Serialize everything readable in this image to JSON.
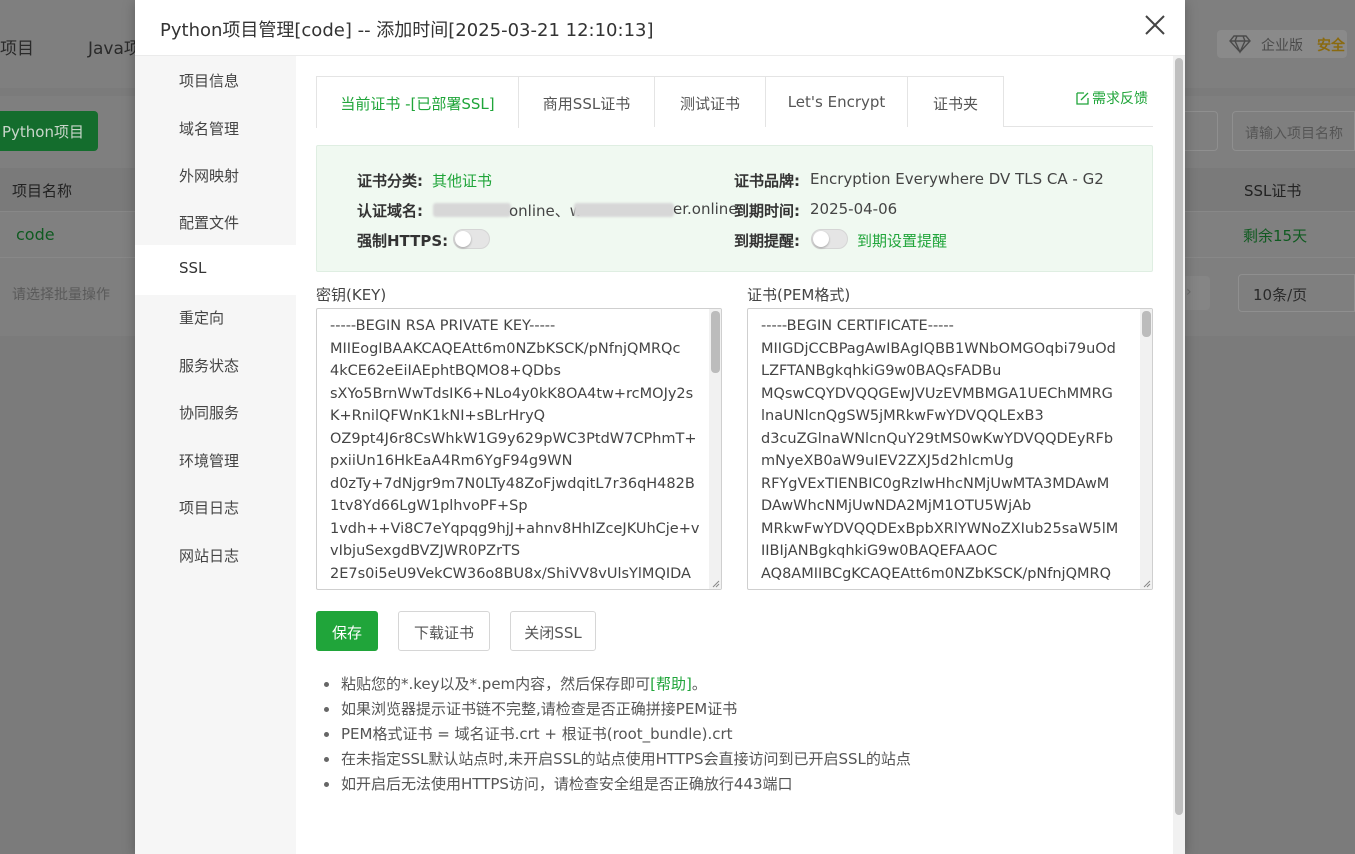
{
  "background": {
    "nav": [
      "项目",
      "Java项"
    ],
    "brand_edition": "企业版",
    "brand_security": "安全",
    "add_project_button": "Python项目",
    "search_placeholder": "请输入项目名称",
    "col_project_name": "项目名称",
    "col_ssl": "SSL证书",
    "row_name": "code",
    "row_ssl": "剩余15天",
    "batch_placeholder": "请选择批量操作",
    "page_size": "10条/页"
  },
  "dialog": {
    "title": "Python项目管理[code] -- 添加时间[2025-03-21 12:10:13]",
    "sidebar": [
      {
        "label": "项目信息"
      },
      {
        "label": "域名管理"
      },
      {
        "label": "外网映射"
      },
      {
        "label": "配置文件"
      },
      {
        "label": "SSL"
      },
      {
        "label": "重定向"
      },
      {
        "label": "服务状态"
      },
      {
        "label": "协同服务"
      },
      {
        "label": "环境管理"
      },
      {
        "label": "项目日志"
      },
      {
        "label": "网站日志"
      }
    ],
    "tabs": [
      {
        "label": "当前证书 -[已部署SSL]"
      },
      {
        "label": "商用SSL证书"
      },
      {
        "label": "测试证书"
      },
      {
        "label": "Let's Encrypt"
      },
      {
        "label": "证书夹"
      }
    ],
    "feedback": "需求反馈",
    "cert_info": {
      "category_label": "证书分类:",
      "category_value": "其他证书",
      "brand_label": "证书品牌:",
      "brand_value": "Encryption Everywhere DV TLS CA - G2",
      "domain_label": "认证域名:",
      "domain_value_a": "online、w",
      "domain_value_b": "er.online",
      "expiry_label": "到期时间:",
      "expiry_value": "2025-04-06",
      "force_https_label": "强制HTTPS:",
      "reminder_label": "到期提醒:",
      "reminder_link": "到期设置提醒"
    },
    "key_label": "密钥(KEY)",
    "pem_label": "证书(PEM格式)",
    "key_text": "-----BEGIN RSA PRIVATE KEY-----\nMIIEogIBAAKCAQEAtt6m0NZbKSCK/pNfnjQMRQc\n4kCE62eEiIAEphtBQMO8+QDbs\nsXYo5BrnWwTdsIK6+NLo4y0kK8OA4tw+rcMOJy2s\nK+RnilQFWnK1kNI+sBLrHryQ\nOZ9pt4J6r8CsWhkW1G9y629pWC3PtdW7CPhmT+\npxiiUn16HkEaA4Rm6YgF94g9WN\nd0zTy+7dNjgr9m7N0LTy48ZoFjwdqitL7r36qH482B\n1tv8Yd66LgW1plhvoPF+Sp\n1vdh++Vi8C7eYqpqg9hjJ+ahnv8HhIZceJKUhCje+v\nvIbjuSexgdBVZJWR0PZrTS\n2E7s0i5eU9VekCW36o8BU8x/ShiVV8vUlsYlMQIDA",
    "pem_text": "-----BEGIN CERTIFICATE-----\nMIIGDjCCBPagAwIBAgIQBB1WNbOMGOqbi79uOd\nLZFTANBgkqhkiG9w0BAQsFADBu\nMQswCQYDVQQGEwJVUzEVMBMGA1UEChMMRG\nlnaUNlcnQgSW5jMRkwFwYDVQQLExB3\nd3cuZGlnaWNlcnQuY29tMS0wKwYDVQQDEyRFb\nmNyeXB0aW9uIEV2ZXJ5d2hlcmUg\nRFYgVExTIENBIC0gRzIwHhcNMjUwMTA3MDAwM\nDAwWhcNMjUwNDA2MjM1OTU5WjAb\nMRkwFwYDVQQDExBpbXRlYWNoZXIub25saW5lM\nIIBIjANBgkqhkiG9w0BAQEFAAOC\nAQ8AMIIBCgKCAQEAtt6m0NZbKSCK/pNfnjQMRQ",
    "buttons": {
      "save": "保存",
      "download": "下载证书",
      "close_ssl": "关闭SSL"
    },
    "tips": {
      "tip1_before": "粘贴您的*.key以及*.pem内容，然后保存即可",
      "tip1_help": "[帮助]",
      "tip1_after": "。",
      "tip2": "如果浏览器提示证书链不完整,请检查是否正确拼接PEM证书",
      "tip3": "PEM格式证书 = 域名证书.crt + 根证书(root_bundle).crt",
      "tip4": "在未指定SSL默认站点时,未开启SSL的站点使用HTTPS会直接访问到已开启SSL的站点",
      "tip5": "如开启后无法使用HTTPS访问，请检查安全组是否正确放行443端口"
    }
  },
  "colors": {
    "accent": "#20a53a",
    "info_bg": "#f0f9f1"
  }
}
